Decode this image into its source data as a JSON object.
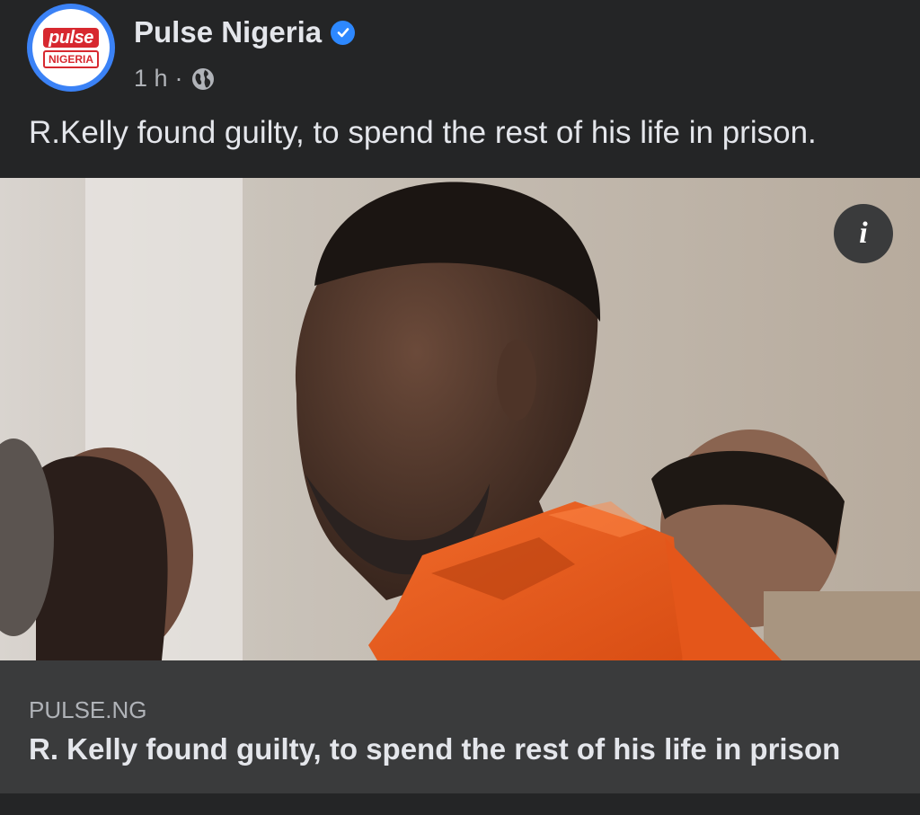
{
  "post": {
    "page_name": "Pulse Nigeria",
    "time": "1 h",
    "separator": "·",
    "audience_icon": "globe-icon",
    "caption": "R.Kelly found guilty, to spend the rest of his life in prison.",
    "avatar_logo": {
      "top": "pulse",
      "bottom": "NIGERIA"
    }
  },
  "link_preview": {
    "domain": "PULSE.NG",
    "title": "R. Kelly found guilty, to spend the rest of his life in prison"
  },
  "info_button": {
    "label": "i"
  },
  "colors": {
    "background": "#242526",
    "link_box": "#3a3b3c",
    "verified": "#2d88ff",
    "brand_red": "#d7282f",
    "avatar_ring": "#3b82f6"
  }
}
